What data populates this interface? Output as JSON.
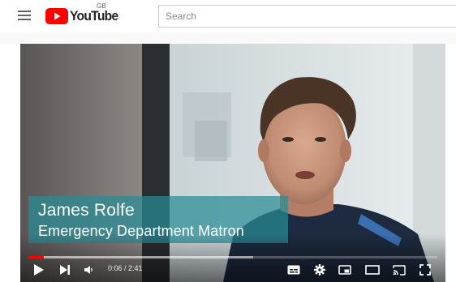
{
  "masthead": {
    "logo_text": "YouTube",
    "region_code": "GB",
    "search_placeholder": "Search"
  },
  "player": {
    "lower_third": {
      "name": "James Rolfe",
      "title": "Emergency Department Matron"
    },
    "controls": {
      "current_time": "0:06",
      "duration": "2:41",
      "separator": " / ",
      "played_fraction": 0.037,
      "buffered_fraction": 0.55
    }
  },
  "colors": {
    "brand_red": "#ff0000",
    "lower_third_teal": "#288c96"
  },
  "icons": [
    "menu-icon",
    "youtube-logo-icon",
    "play-icon",
    "next-icon",
    "volume-icon",
    "subtitles-icon",
    "settings-icon",
    "miniplayer-icon",
    "theater-icon",
    "cast-icon",
    "fullscreen-icon"
  ]
}
